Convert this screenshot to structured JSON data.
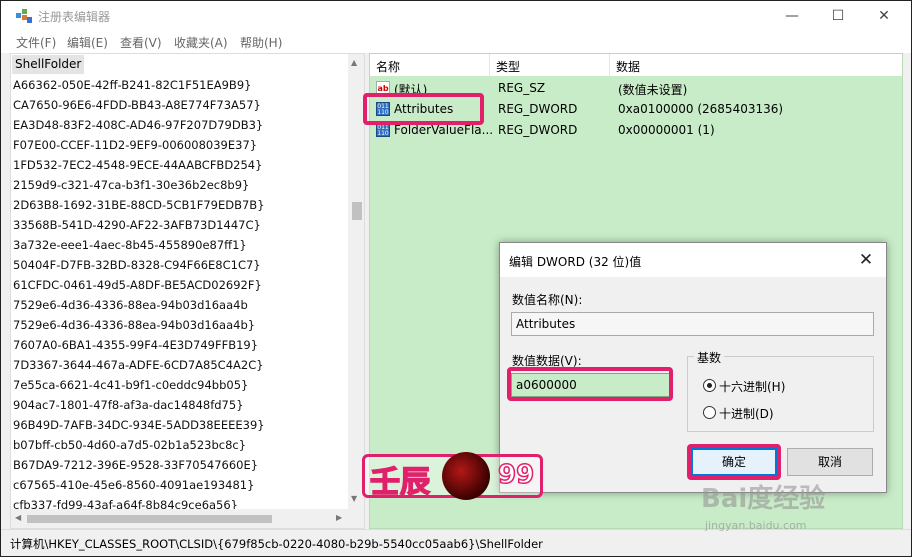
{
  "window": {
    "title": "注册表编辑器",
    "min_glyph": "—",
    "max_glyph": "☐",
    "close_glyph": "✕"
  },
  "menu": {
    "items": [
      "文件(F)",
      "编辑(E)",
      "查看(V)",
      "收藏夹(A)",
      "帮助(H)"
    ]
  },
  "tree": {
    "root": "ShellFolder",
    "items": [
      "A66362-050E-42ff-B241-82C1F51EA9B9}",
      "CA7650-96E6-4FDD-BB43-A8E774F73A57}",
      "EA3D48-83F2-408C-AD46-97F207D79DB3}",
      "F07E00-CCEF-11D2-9EF9-006008039E37}",
      "1FD532-7EC2-4548-9ECE-44AABCFBD254}",
      "2159d9-c321-47ca-b3f1-30e36b2ec8b9}",
      "2D63B8-1692-31BE-88CD-5CB1F79EDB7B}",
      "33568B-541D-4290-AF22-3AFB73D1447C}",
      "3a732e-eee1-4aec-8b45-455890e87ff1}",
      "50404F-D7FB-32BD-8328-C94F66E8C1C7}",
      "61CFDC-0461-49d5-A8DF-BE5ACD02692F}",
      "7529e6-4d36-4336-88ea-94b03d16aa4b",
      "7529e6-4d36-4336-88ea-94b03d16aa4b}",
      "7607A0-6BA1-4355-99F4-4E3D749FFB19}",
      "7D3367-3644-467a-ADFE-6CD7A85C4A2C}",
      "7e55ca-6621-4c41-b9f1-c0eddc94bb05}",
      "904ac7-1801-47f8-af3a-dac14848fd75}",
      "96B49D-7AFB-34DC-934E-5ADD38EEEE39}",
      "b07bff-cb50-4d60-a7d5-02b1a523bc8c}",
      "B67DA9-7212-396E-9528-33F70547660E}",
      "c67565-410e-45e6-8560-4091ae193481}",
      "cfb337-fd99-43af-a64f-8b84c9ce6a56}"
    ]
  },
  "values": {
    "headers": {
      "name": "名称",
      "type": "类型",
      "data": "数据"
    },
    "rows": [
      {
        "name": "(默认)",
        "type": "REG_SZ",
        "data": "(数值未设置)",
        "icon": "ab",
        "icon_name": "string-value-icon"
      },
      {
        "name": "Attributes",
        "type": "REG_DWORD",
        "data": "0xa0100000 (2685403136)",
        "icon": "011 110",
        "icon_name": "dword-value-icon"
      },
      {
        "name": "FolderValueFla...",
        "type": "REG_DWORD",
        "data": "0x00000001 (1)",
        "icon": "011 110",
        "icon_name": "dword-value-icon"
      }
    ]
  },
  "status": {
    "path": "计算机\\HKEY_CLASSES_ROOT\\CLSID\\{679f85cb-0220-4080-b29b-5540cc05aab6}\\ShellFolder"
  },
  "dialog": {
    "title": "编辑 DWORD (32 位)值",
    "close_glyph": "✕",
    "name_label": "数值名称(N):",
    "name_value": "Attributes",
    "data_label": "数值数据(V):",
    "data_value": "a0600000",
    "radix_label": "基数",
    "radix_hex": "十六进制(H)",
    "radix_dec": "十进制(D)",
    "radix_selected": "hex",
    "ok": "确定",
    "cancel": "取消"
  },
  "watermark": {
    "logo_text1": "壬辰",
    "logo_text2": "99",
    "baidu": "Bai度经验",
    "baidu_sub": "jingyan.baidu.com"
  },
  "colors": {
    "highlight": "#e0206b",
    "value_pane_bg": "#c8ecc8",
    "ok_border": "#0078d7"
  }
}
